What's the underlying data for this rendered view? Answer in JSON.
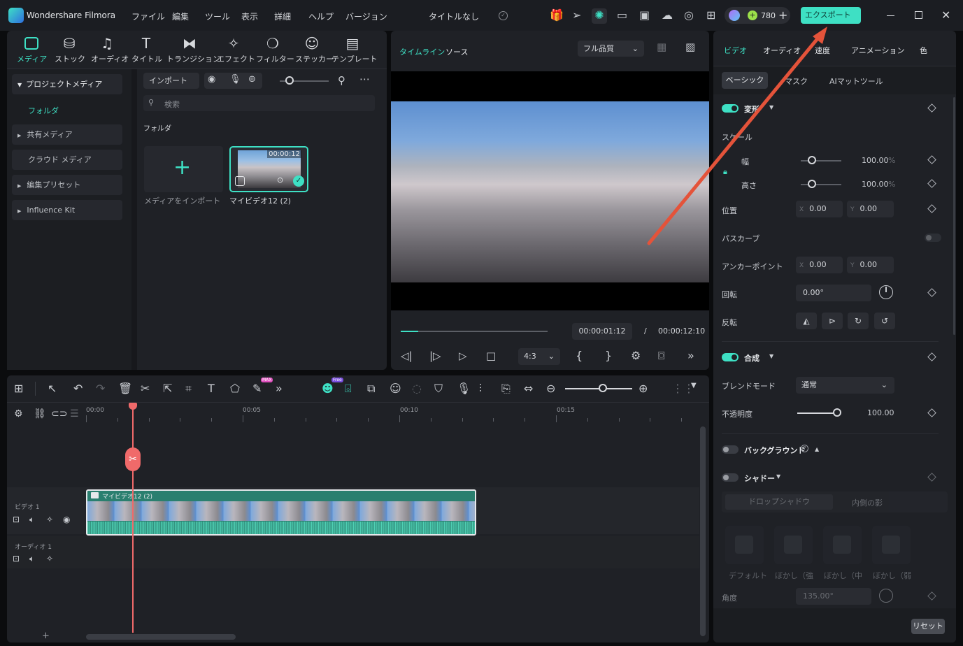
{
  "app": {
    "name": "Wondershare Filmora",
    "title": "タイトルなし",
    "credits": "780",
    "export_label": "エクスポート"
  },
  "menu": [
    "ファイル",
    "編集",
    "ツール",
    "表示",
    "詳細",
    "ヘルプ",
    "バージョン"
  ],
  "media_tabs": [
    {
      "label": "メディア",
      "icon": "media-icon"
    },
    {
      "label": "ストック",
      "icon": "stock-icon"
    },
    {
      "label": "オーディオ",
      "icon": "music-icon"
    },
    {
      "label": "タイトル",
      "icon": "title-icon"
    },
    {
      "label": "トランジション",
      "icon": "transition-icon"
    },
    {
      "label": "エフェクト",
      "icon": "effect-icon"
    },
    {
      "label": "フィルター",
      "icon": "filter-icon"
    },
    {
      "label": "ステッカー",
      "icon": "sticker-icon"
    },
    {
      "label": "テンプレート",
      "icon": "template-icon"
    }
  ],
  "sidebar": {
    "project_media": "プロジェクトメディア",
    "folder": "フォルダ",
    "shared_media": "共有メディア",
    "cloud_media": "クラウド メディア",
    "edit_preset": "編集プリセット",
    "influence_kit": "Influence Kit"
  },
  "media": {
    "import_label": "インポート",
    "search_placeholder": "検索",
    "folder_heading": "フォルダ",
    "import_tile_label": "メディアをインポート",
    "clip_name": "マイビデオ12 (2)",
    "clip_duration": "00:00:12"
  },
  "preview": {
    "tab_timeline": "タイムライン",
    "tab_source": "ソース",
    "quality": "フル品質",
    "current_time": "00:00:01:12",
    "separator": "/",
    "total_time": "00:00:12:10",
    "aspect": "4:3",
    "progress": 0.12
  },
  "props": {
    "tabs": [
      "ビデオ",
      "オーディオ",
      "速度",
      "アニメーション",
      "色"
    ],
    "subtabs": [
      "ベーシック",
      "マスク",
      "AIマットツール"
    ],
    "transform": "変形",
    "scale": "スケール",
    "width": "幅",
    "height": "高さ",
    "width_value": "100.00",
    "height_value": "100.00",
    "percent": "%",
    "position": "位置",
    "x_label": "X",
    "y_label": "Y",
    "pos_x": "0.00",
    "pos_y": "0.00",
    "path_curve": "パスカーブ",
    "anchor": "アンカーポイント",
    "anchor_x": "0.00",
    "anchor_y": "0.00",
    "rotation": "回転",
    "rotation_value": "0.00°",
    "flip": "反転",
    "compositing": "合成",
    "blend_mode": "ブレンドモード",
    "blend_value": "通常",
    "opacity": "不透明度",
    "opacity_value": "100.00",
    "background": "バックグラウンド",
    "shadow": "シャドー",
    "drop_shadow": "ドロップシャドウ",
    "inner_shadow": "内側の影",
    "presets": [
      "デフォルト",
      "ぼかし（強",
      "ぼかし（中",
      "ぼかし（弱"
    ],
    "angle": "角度",
    "angle_value": "135.00°",
    "reset": "リセット"
  },
  "timeline": {
    "ruler": [
      "00:00",
      "00:05",
      "00:10",
      "00:15"
    ],
    "video_track": "ビデオ 1",
    "audio_track": "オーディオ 1",
    "clip_label": "マイビデオ12 (2)",
    "badge_max": "MAX",
    "badge_free": "Free"
  },
  "colors": {
    "accent": "#3ee0c4",
    "playhead": "#f06a6a",
    "arrow": "#e4533a",
    "clip": "#2a7f6f"
  }
}
